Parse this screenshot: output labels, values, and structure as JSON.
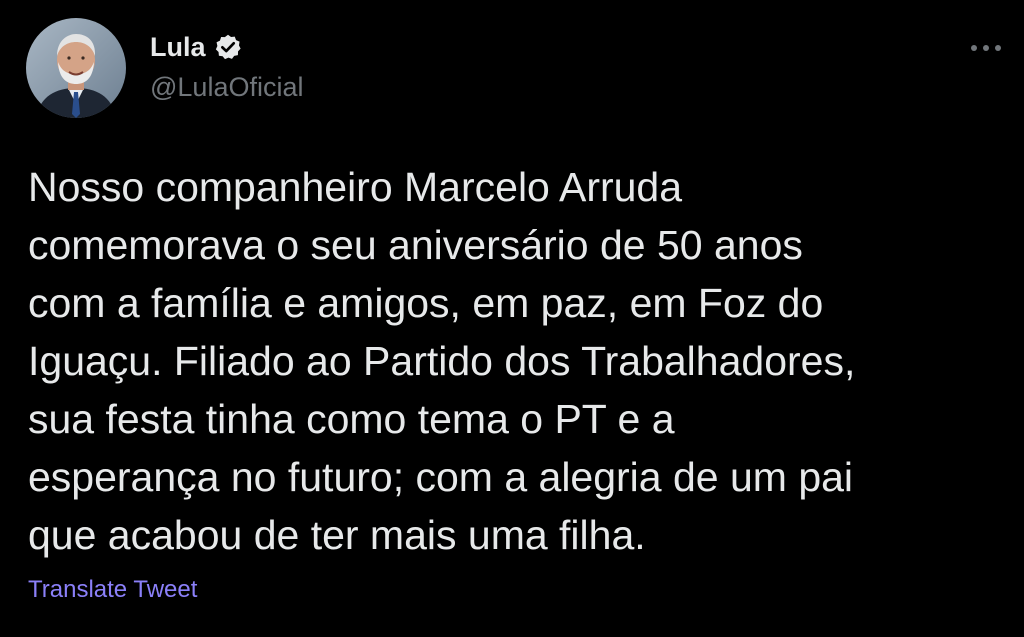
{
  "author": {
    "display_name": "Lula",
    "handle": "@LulaOficial",
    "verified": true,
    "avatar_icon": "profile-photo"
  },
  "tweet": {
    "lines": [
      "Nosso companheiro Marcelo Arruda",
      "comemorava o seu aniversário de 50 anos",
      "com a família e amigos, em paz, em Foz do",
      "Iguaçu. Filiado ao Partido dos Trabalhadores,",
      "sua festa tinha como tema o PT e a",
      "esperança no futuro; com a alegria de um pai",
      "que acabou de ter mais uma filha."
    ],
    "translate_label": "Translate Tweet"
  },
  "icons": {
    "verified": "verified-badge-icon",
    "more": "more-options-icon"
  },
  "colors": {
    "background": "#000000",
    "text": "#e7e9ea",
    "secondary_text": "#71767b",
    "link": "#8b80f9"
  }
}
